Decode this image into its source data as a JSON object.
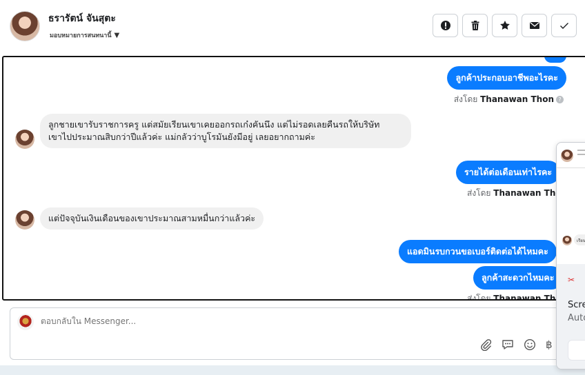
{
  "header": {
    "contact_name": "ธรารัตน์ จันสุตะ",
    "assign_label": "มอบหมายการสนทนานี้",
    "actions": [
      "alert-icon",
      "trash-icon",
      "star-icon",
      "envelope-icon",
      "check-icon"
    ]
  },
  "messages": {
    "out_partial": "",
    "out1": "ลูกค้าประกอบอาชีพอะไรคะ",
    "sent_by_prefix": "ส่งโดย",
    "agent_name": "Thanawan Thon",
    "in1_line1": "ลูกชายเขารับราชการครู แต่สมัยเรียนเขาเคยออกรถเก๋งคันนึง แต่ไม่รอดเลยคืนรถให้บริษัท",
    "in1_line2": "เขาไปประมาณสิบกว่าปีแล้วค่ะ แม่กลัวว่าบูโรมันยังมีอยู่ เลยอยากถามค่ะ",
    "out2": "รายได้ต่อเดือนเท่าไรคะ",
    "in2": "แต่ปัจจุบันเงินเดือนของเขาประมาณสามหมื่นกว่าแล้วค่ะ",
    "out3": "แอดมินรบกวนขอเบอร์ติดต่อได้ไหมคะ",
    "out4": "ลูกค้าสะดวกไหมคะ"
  },
  "composer": {
    "placeholder": "ตอบกลับใน Messenger...",
    "tools": [
      "paperclip-icon",
      "saved-reply-icon",
      "emoji-icon",
      "baht-icon"
    ],
    "baht_symbol": "฿"
  },
  "side_panel": {
    "mini_text": "เรียน",
    "notif_title": "Scre",
    "notif_sub": "Auto"
  },
  "colors": {
    "outgoing_bubble": "#0a7cff",
    "incoming_bubble": "#f0f0f0",
    "thread_border": "#111111"
  }
}
